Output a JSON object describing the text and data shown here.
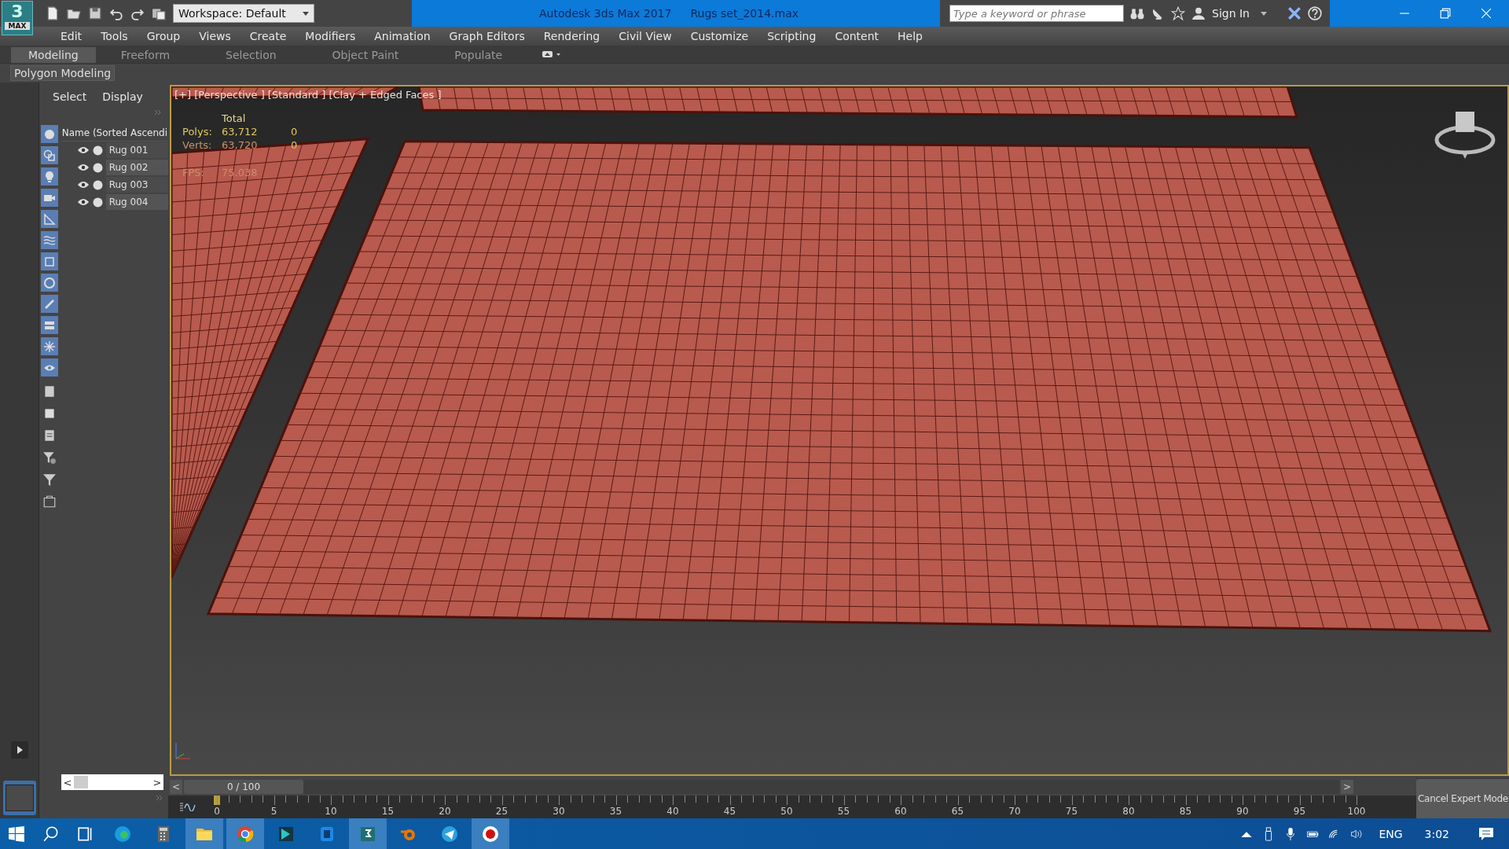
{
  "title_bar": {
    "logo_digit": "3",
    "logo_text": "MAX",
    "workspace": "Workspace: Default",
    "app_title": "Autodesk 3ds Max 2017",
    "file_name": "Rugs set_2014.max",
    "search": {
      "placeholder": "Type a keyword or phrase"
    },
    "sign_in": "Sign In"
  },
  "menu": [
    "Edit",
    "Tools",
    "Group",
    "Views",
    "Create",
    "Modifiers",
    "Animation",
    "Graph Editors",
    "Rendering",
    "Civil View",
    "Customize",
    "Scripting",
    "Content",
    "Help"
  ],
  "ribbon_tabs": [
    {
      "label": "Modeling",
      "selected": true
    },
    {
      "label": "Freeform",
      "selected": false
    },
    {
      "label": "Selection",
      "selected": false
    },
    {
      "label": "Object Paint",
      "selected": false
    },
    {
      "label": "Populate",
      "selected": false
    }
  ],
  "ribbon_panel": "Polygon Modeling",
  "scene_explorer": {
    "tabs": [
      "Select",
      "Display"
    ],
    "column": "Name (Sorted Ascendi",
    "rows": [
      {
        "name": "Rug 001"
      },
      {
        "name": "Rug 002"
      },
      {
        "name": "Rug 003"
      },
      {
        "name": "Rug 004"
      }
    ]
  },
  "viewport": {
    "label": "[+] [Perspective ] [Standard ] [Clay + Edged Faces ]",
    "stats": {
      "header": "Total",
      "rows": [
        {
          "label": "Polys:",
          "total": "63,712",
          "selected": "0"
        },
        {
          "label": "Verts:",
          "total": "63,720",
          "selected": "0"
        }
      ],
      "fps_label": "FPS:",
      "fps": "75.038"
    }
  },
  "timeline": {
    "frame": "0 / 100",
    "level": 0,
    "prev": "<",
    "next": ">",
    "ticks": [
      "0",
      "5",
      "10",
      "15",
      "20",
      "25",
      "30",
      "35",
      "40",
      "45",
      "50",
      "55",
      "60",
      "65",
      "70",
      "75",
      "80",
      "85",
      "90",
      "95",
      "100"
    ]
  },
  "explorer_scroll": {
    "prev": "<",
    "next": ">"
  },
  "cancel_expert_mode": "Cancel Expert Mode",
  "taskbar": {
    "apps": [
      {
        "kind": "edge",
        "selected": false
      },
      {
        "kind": "calculator",
        "selected": false
      },
      {
        "kind": "folder",
        "selected": true
      },
      {
        "kind": "chrome",
        "selected": true
      },
      {
        "kind": "app",
        "selected": false
      },
      {
        "kind": "app2",
        "selected": false
      },
      {
        "kind": "max",
        "selected": true
      },
      {
        "kind": "blender",
        "selected": false
      },
      {
        "kind": "telegram",
        "selected": false
      },
      {
        "kind": "record",
        "selected": true
      }
    ],
    "language": "ENG",
    "time": "3:02"
  }
}
